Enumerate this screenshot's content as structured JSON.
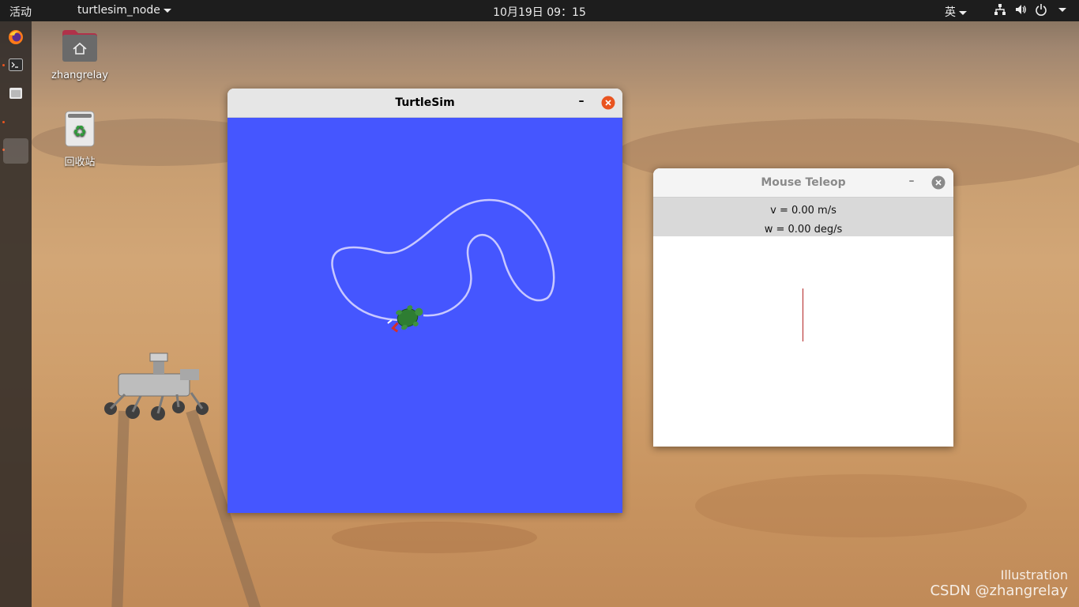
{
  "topbar": {
    "activities": "活动",
    "app_menu": "turtlesim_node",
    "clock": "10月19日  09：15",
    "input_method": "英"
  },
  "dock": {
    "items": [
      "firefox-icon",
      "terminal-icon",
      "files-icon",
      "window-icon"
    ],
    "show_apps_icon": "grid-icon"
  },
  "desktop": {
    "home_folder_label": "zhangrelay",
    "trash_label": "回收站"
  },
  "turtlesim": {
    "title": "TurtleSim",
    "minimize": "–",
    "background_color": "#4556ff"
  },
  "teleop": {
    "title": "Mouse Teleop",
    "minimize": "–",
    "v_readout": "v = 0.00 m/s",
    "w_readout": "w = 0.00 deg/s"
  },
  "watermark": {
    "line1": "Illustration",
    "line2": "CSDN @zhangrelay"
  },
  "colors": {
    "ubuntu_orange": "#e95420",
    "turtle_path": "#c8c8ff"
  }
}
